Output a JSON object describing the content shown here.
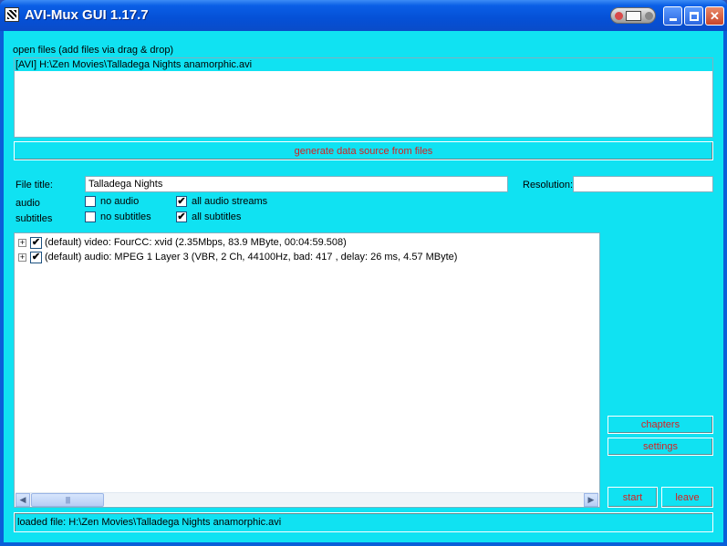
{
  "window": {
    "title": "AVI-Mux GUI 1.17.7",
    "icon": "app-icon"
  },
  "files": {
    "heading": "open files (add files via drag & drop)",
    "items": [
      "[AVI] H:\\Zen Movies\\Talladega Nights anamorphic.avi"
    ],
    "generate_button": "generate data source from files"
  },
  "fields": {
    "file_title_label": "File title:",
    "file_title_value": "Talladega Nights",
    "resolution_label": "Resolution:",
    "resolution_value": ""
  },
  "audio": {
    "label": "audio",
    "no_audio": {
      "label": "no audio",
      "checked": false
    },
    "all_streams": {
      "label": "all audio streams",
      "checked": true
    }
  },
  "subtitles": {
    "label": "subtitles",
    "no_subtitles": {
      "label": "no subtitles",
      "checked": false
    },
    "all_subtitles": {
      "label": "all subtitles",
      "checked": true
    }
  },
  "streams": [
    {
      "checked": true,
      "text": "(default) video: FourCC: xvid (2.35Mbps, 83.9 MByte, 00:04:59.508)"
    },
    {
      "checked": true,
      "text": "(default) audio: MPEG 1 Layer 3 (VBR, 2 Ch, 44100Hz, bad: 417 , delay: 26 ms, 4.57 MByte)"
    }
  ],
  "buttons": {
    "chapters": "chapters",
    "settings": "settings",
    "start": "start",
    "leave": "leave"
  },
  "status": "loaded file: H:\\Zen Movies\\Talladega Nights anamorphic.avi",
  "colors": {
    "background": "#10e2f2",
    "button_text": "#d81e1e",
    "titlebar": "#0a5fe6"
  }
}
